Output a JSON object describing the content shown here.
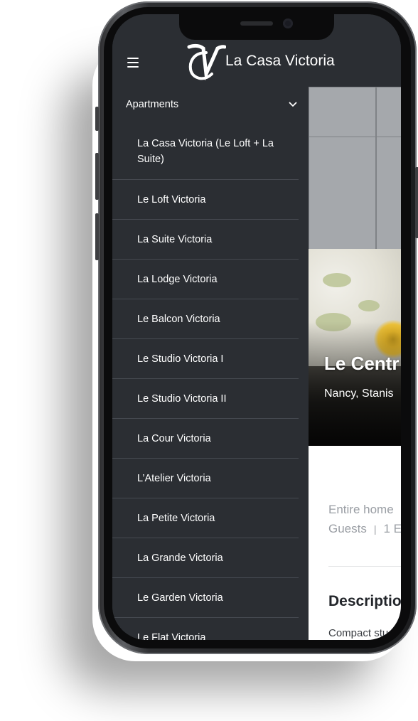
{
  "brand": {
    "logo_monogram": "VC",
    "name": "La Casa Victoria"
  },
  "icons": {
    "menu": "hamburger-icon",
    "expand": "chevron-down-icon"
  },
  "colors": {
    "menu_background": "#2b2e33",
    "menu_divider": "#464a51",
    "text_light": "#ffffff",
    "text_muted": "#9a9ea4",
    "text_dark": "#22252a"
  },
  "menu": {
    "section_label": "Apartments",
    "items": [
      {
        "label": "La Casa Victoria (Le Loft + La Suite)"
      },
      {
        "label": "Le Loft Victoria"
      },
      {
        "label": "La Suite Victoria"
      },
      {
        "label": "La Lodge Victoria"
      },
      {
        "label": "Le Balcon Victoria"
      },
      {
        "label": "Le Studio Victoria I"
      },
      {
        "label": "Le Studio Victoria II"
      },
      {
        "label": "La Cour Victoria"
      },
      {
        "label": "L’Atelier Victoria"
      },
      {
        "label": "La Petite Victoria"
      },
      {
        "label": "La Grande Victoria"
      },
      {
        "label": "Le Garden Victoria"
      },
      {
        "label": "Le Flat Victoria"
      }
    ]
  },
  "listing": {
    "title": "Le Centr",
    "location": "Nancy, Stanis",
    "stay_type": "Entire home",
    "guests_label": "Guests",
    "separator": "|",
    "bedrooms_partial": "1 E",
    "description_heading": "Descriptio",
    "description_text": "Compact stud"
  }
}
